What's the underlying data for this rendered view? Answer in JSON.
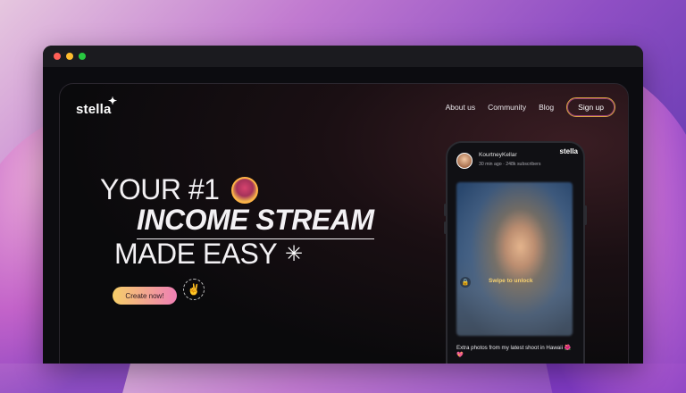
{
  "app": {
    "brand": "stella",
    "brand_icon": "sparkle-icon"
  },
  "nav": {
    "items": [
      "About us",
      "Community",
      "Blog"
    ],
    "signup": "Sign up"
  },
  "hero": {
    "line1": "YOUR #1",
    "line2": "INCOME STREAM",
    "line3": "MADE EASY",
    "cta": "Create now!"
  },
  "phone": {
    "profile_name": "KourtneyKellar",
    "profile_meta": "30 min ago · 248k subscribers",
    "photo_logo": "stella",
    "swipe_text": "Swipe to unlock",
    "caption": "Extra photos from my latest shoot in Hawaii 🌺💖"
  },
  "colors": {
    "accent_gold": "#d9a441",
    "accent_pink": "#ef7fb5"
  }
}
